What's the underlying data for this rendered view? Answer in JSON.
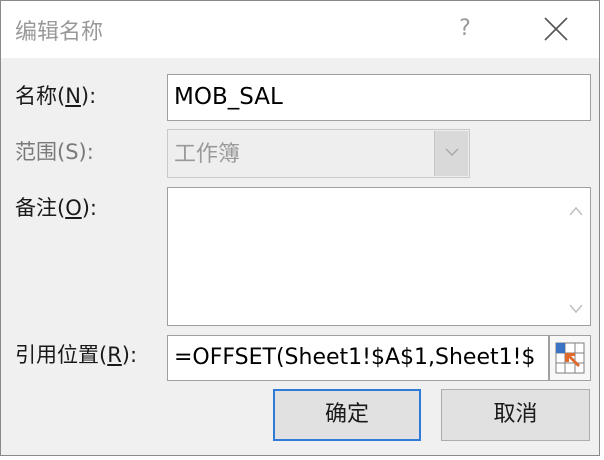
{
  "dialog": {
    "title": "编辑名称",
    "help_label": "?"
  },
  "name_field": {
    "label_prefix": "名称(",
    "label_key": "N",
    "label_suffix": "):",
    "value": "MOB_SAL"
  },
  "scope_field": {
    "label": "范围(S):",
    "value": "工作簿"
  },
  "comment_field": {
    "label_prefix": "备注(",
    "label_key": "O",
    "label_suffix": "):",
    "value": ""
  },
  "refers_to_field": {
    "label_prefix": "引用位置(",
    "label_key": "R",
    "label_suffix": "):",
    "value": "=OFFSET(Sheet1!$A$1,Sheet1!$"
  },
  "buttons": {
    "ok_label": "确定",
    "cancel_label": "取消"
  },
  "icons": {
    "close": "close-icon",
    "dropdown": "chevron-down-icon",
    "scroll_up": "chevron-up-icon",
    "scroll_down": "chevron-down-icon",
    "range_picker": "collapse-dialog-icon"
  },
  "colors": {
    "accent": "#2f7cd8",
    "range_icon_blue": "#3b72c4",
    "range_icon_orange": "#e06a2c"
  }
}
